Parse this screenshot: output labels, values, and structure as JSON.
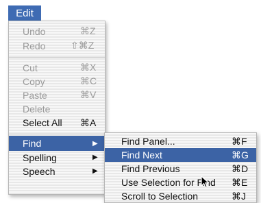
{
  "menu_title": "Edit",
  "edit_menu": {
    "items": [
      {
        "label": "Undo",
        "shortcut": "⌘Z",
        "enabled": false
      },
      {
        "label": "Redo",
        "shortcut": "⇧⌘Z",
        "enabled": false
      },
      {
        "label": "Cut",
        "shortcut": "⌘X",
        "enabled": false
      },
      {
        "label": "Copy",
        "shortcut": "⌘C",
        "enabled": false
      },
      {
        "label": "Paste",
        "shortcut": "⌘V",
        "enabled": false
      },
      {
        "label": "Delete",
        "shortcut": "",
        "enabled": false
      },
      {
        "label": "Select All",
        "shortcut": "⌘A",
        "enabled": true
      },
      {
        "label": "Find",
        "submenu": true,
        "selected": true
      },
      {
        "label": "Spelling",
        "submenu": true
      },
      {
        "label": "Speech",
        "submenu": true
      }
    ]
  },
  "find_submenu": {
    "items": [
      {
        "label": "Find Panel...",
        "shortcut": "⌘F"
      },
      {
        "label": "Find Next",
        "shortcut": "⌘G",
        "selected": true
      },
      {
        "label": "Find Previous",
        "shortcut": "⌘D"
      },
      {
        "label": "Use Selection for Find",
        "shortcut": "⌘E"
      },
      {
        "label": "Scroll to Selection",
        "shortcut": "⌘J"
      }
    ]
  },
  "icons": {
    "submenu_arrow": "submenu-arrow-icon",
    "cursor": "mouse-pointer-icon"
  },
  "colors": {
    "highlight": "#3c63a5",
    "title_bg": "#3e6bb3",
    "disabled_text": "#9a9a9a"
  }
}
